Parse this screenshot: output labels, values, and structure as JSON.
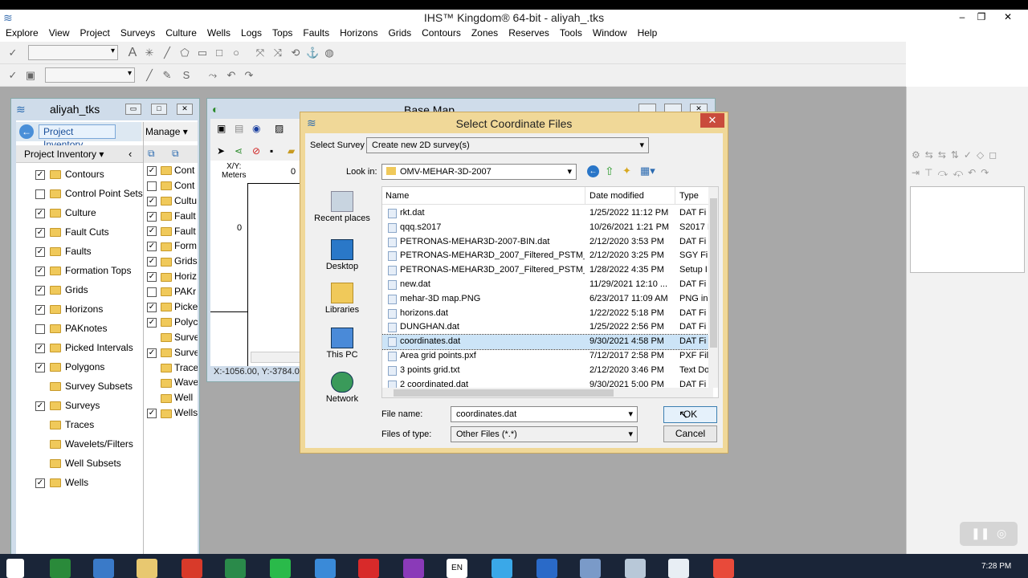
{
  "app": {
    "title": "IHS™ Kingdom® 64-bit - aliyah_.tks"
  },
  "window_controls": {
    "minimize": "–",
    "restore": "❐",
    "close": "✕"
  },
  "menu": [
    "Explore",
    "View",
    "Project",
    "Surveys",
    "Culture",
    "Wells",
    "Logs",
    "Tops",
    "Faults",
    "Horizons",
    "Grids",
    "Contours",
    "Zones",
    "Reserves",
    "Tools",
    "Window",
    "Help"
  ],
  "project_window": {
    "title": "aliyah_tks",
    "tab_inventory": "Project Inventory",
    "manage_label": "Manage ▾",
    "inventory_header": "Project Inventory ▾",
    "items": [
      {
        "label": "Contours",
        "checked": true
      },
      {
        "label": "Control Point Sets",
        "checked": false
      },
      {
        "label": "Culture",
        "checked": true
      },
      {
        "label": "Fault Cuts",
        "checked": true
      },
      {
        "label": "Faults",
        "checked": true
      },
      {
        "label": "Formation Tops",
        "checked": true
      },
      {
        "label": "Grids",
        "checked": true
      },
      {
        "label": "Horizons",
        "checked": true
      },
      {
        "label": "PAKnotes",
        "checked": false
      },
      {
        "label": "Picked Intervals",
        "checked": true
      },
      {
        "label": "Polygons",
        "checked": true
      },
      {
        "label": "Survey Subsets",
        "checked": null
      },
      {
        "label": "Surveys",
        "checked": true
      },
      {
        "label": "Traces",
        "checked": null
      },
      {
        "label": "Wavelets/Filters",
        "checked": null
      },
      {
        "label": "Well Subsets",
        "checked": null
      },
      {
        "label": "Wells",
        "checked": true
      }
    ],
    "col2_items": [
      {
        "label": "Cont",
        "checked": true
      },
      {
        "label": "Cont",
        "checked": false
      },
      {
        "label": "Cultu",
        "checked": true
      },
      {
        "label": "Fault",
        "checked": true
      },
      {
        "label": "Fault",
        "checked": true
      },
      {
        "label": "Form",
        "checked": true
      },
      {
        "label": "Grids",
        "checked": true
      },
      {
        "label": "Horiz",
        "checked": true
      },
      {
        "label": "PAKr",
        "checked": false
      },
      {
        "label": "Picke",
        "checked": true
      },
      {
        "label": "Polyc",
        "checked": true
      },
      {
        "label": "Surve",
        "checked": null
      },
      {
        "label": "Surve",
        "checked": true
      },
      {
        "label": "Trace",
        "checked": null
      },
      {
        "label": "Wave",
        "checked": null
      },
      {
        "label": "Well",
        "checked": null
      },
      {
        "label": "Wells",
        "checked": true
      }
    ]
  },
  "base_map": {
    "title": "Base Map",
    "xy_label": "X/Y:",
    "units": "Meters",
    "tick_zero": "0",
    "status": "X:-1056.00, Y:-3784.00"
  },
  "dialog": {
    "title": "Select Coordinate Files",
    "survey_label": "Select Survey",
    "survey_value": "Create new 2D survey(s)",
    "lookin_label": "Look in:",
    "lookin_value": "OMV-MEHAR-3D-2007",
    "places": [
      "Recent places",
      "Desktop",
      "Libraries",
      "This PC",
      "Network"
    ],
    "columns": {
      "name": "Name",
      "date": "Date modified",
      "type": "Type"
    },
    "files": [
      {
        "name": "rkt.dat",
        "date": "1/25/2022 11:12 PM",
        "type": "DAT Fi"
      },
      {
        "name": "qqq.s2017",
        "date": "10/26/2021 1:21 PM",
        "type": "S2017 I"
      },
      {
        "name": "PETRONAS-MEHAR3D-2007-BIN.dat",
        "date": "2/12/2020 3:53 PM",
        "type": "DAT Fi"
      },
      {
        "name": "PETRONAS-MEHAR3D_2007_Filtered_PSTM_...",
        "date": "2/12/2020 3:25 PM",
        "type": "SGY Fil"
      },
      {
        "name": "PETRONAS-MEHAR3D_2007_Filtered_PSTM_...",
        "date": "1/28/2022 4:35 PM",
        "type": "Setup I"
      },
      {
        "name": "new.dat",
        "date": "11/29/2021 12:10 ...",
        "type": "DAT Fi"
      },
      {
        "name": "mehar-3D map.PNG",
        "date": "6/23/2017 11:09 AM",
        "type": "PNG in"
      },
      {
        "name": "horizons.dat",
        "date": "1/22/2022 5:18 PM",
        "type": "DAT Fi"
      },
      {
        "name": "DUNGHAN.dat",
        "date": "1/25/2022 2:56 PM",
        "type": "DAT Fi"
      },
      {
        "name": "coordinates.dat",
        "date": "9/30/2021 4:58 PM",
        "type": "DAT Fi",
        "selected": true
      },
      {
        "name": "Area grid points.pxf",
        "date": "7/12/2017 2:58 PM",
        "type": "PXF Fil"
      },
      {
        "name": "3 points grid.txt",
        "date": "2/12/2020 3:46 PM",
        "type": "Text Do"
      },
      {
        "name": "2 coordinated.dat",
        "date": "9/30/2021 5:00 PM",
        "type": "DAT Fi"
      }
    ],
    "filename_label": "File name:",
    "filename_value": "coordinates.dat",
    "filetype_label": "Files of type:",
    "filetype_value": "Other Files (*.*)",
    "ok_label": "OK",
    "cancel_label": "Cancel"
  },
  "taskbar": {
    "clock": "7:28 PM",
    "lang": "EN"
  }
}
